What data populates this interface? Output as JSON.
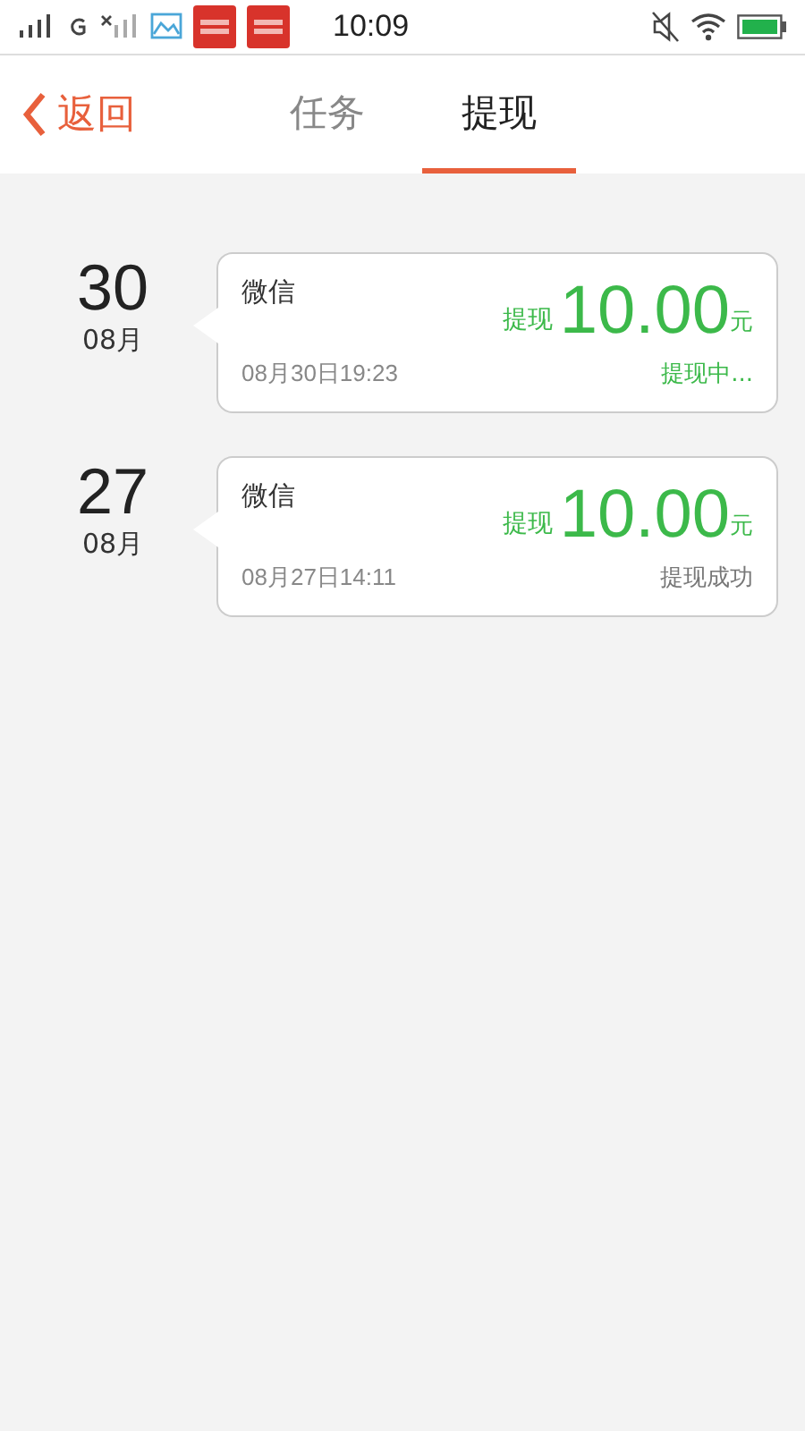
{
  "status_bar": {
    "time": "10:09"
  },
  "nav": {
    "back": "返回",
    "tabs": [
      {
        "label": "任务",
        "selected": false
      },
      {
        "label": "提现",
        "selected": true
      }
    ]
  },
  "records": [
    {
      "day": "30",
      "month": "08月",
      "channel": "微信",
      "amount_label": "提现",
      "amount": "10.00",
      "unit": "元",
      "time": "08月30日19:23",
      "status": "提现中...",
      "done": false
    },
    {
      "day": "27",
      "month": "08月",
      "channel": "微信",
      "amount_label": "提现",
      "amount": "10.00",
      "unit": "元",
      "time": "08月27日14:11",
      "status": "提现成功",
      "done": true
    }
  ]
}
